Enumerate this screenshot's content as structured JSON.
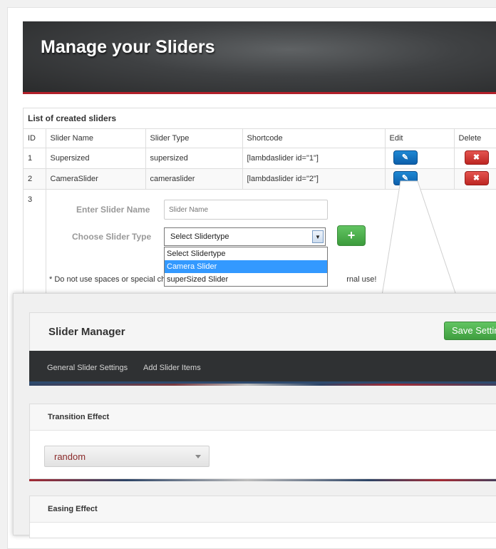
{
  "header": {
    "title": "Manage your Sliders"
  },
  "list": {
    "caption": "List of created sliders",
    "columns": [
      "ID",
      "Slider Name",
      "Slider Type",
      "Shortcode",
      "Edit",
      "Delete"
    ],
    "rows": [
      {
        "id": "1",
        "name": "Supersized",
        "type": "supersized",
        "shortcode": "[lambdaslider id=\"1\"]"
      },
      {
        "id": "2",
        "name": "CameraSlider",
        "type": "cameraslider",
        "shortcode": "[lambdaslider id=\"2\"]"
      }
    ],
    "new_row_id": "3"
  },
  "form": {
    "name_label": "Enter Slider Name",
    "name_placeholder": "Slider Name",
    "type_label": "Choose Slider Type",
    "type_selected": "Select Slidertype",
    "options": [
      "Select Slidertype",
      "Camera Slider",
      "superSized Slider"
    ],
    "add_label": "+",
    "note_start": "* Do not use spaces or special ch",
    "note_end": "rnal use!"
  },
  "manager": {
    "title": "Slider Manager",
    "save_label": "Save Settings",
    "nav": [
      "General Slider Settings",
      "Add Slider Items"
    ],
    "sections": [
      {
        "title": "Transition Effect",
        "value": "random"
      },
      {
        "title": "Easing Effect"
      }
    ]
  },
  "colors": {
    "accent_red": "#b1202a",
    "edit_blue": "#0d5fab",
    "delete_red": "#bd2622",
    "add_green": "#3c9b3c",
    "highlight": "#3399ff"
  },
  "icons": {
    "edit": "edit-icon",
    "delete": "delete-icon",
    "add": "plus-icon",
    "dropdown": "chevron-down-icon"
  }
}
